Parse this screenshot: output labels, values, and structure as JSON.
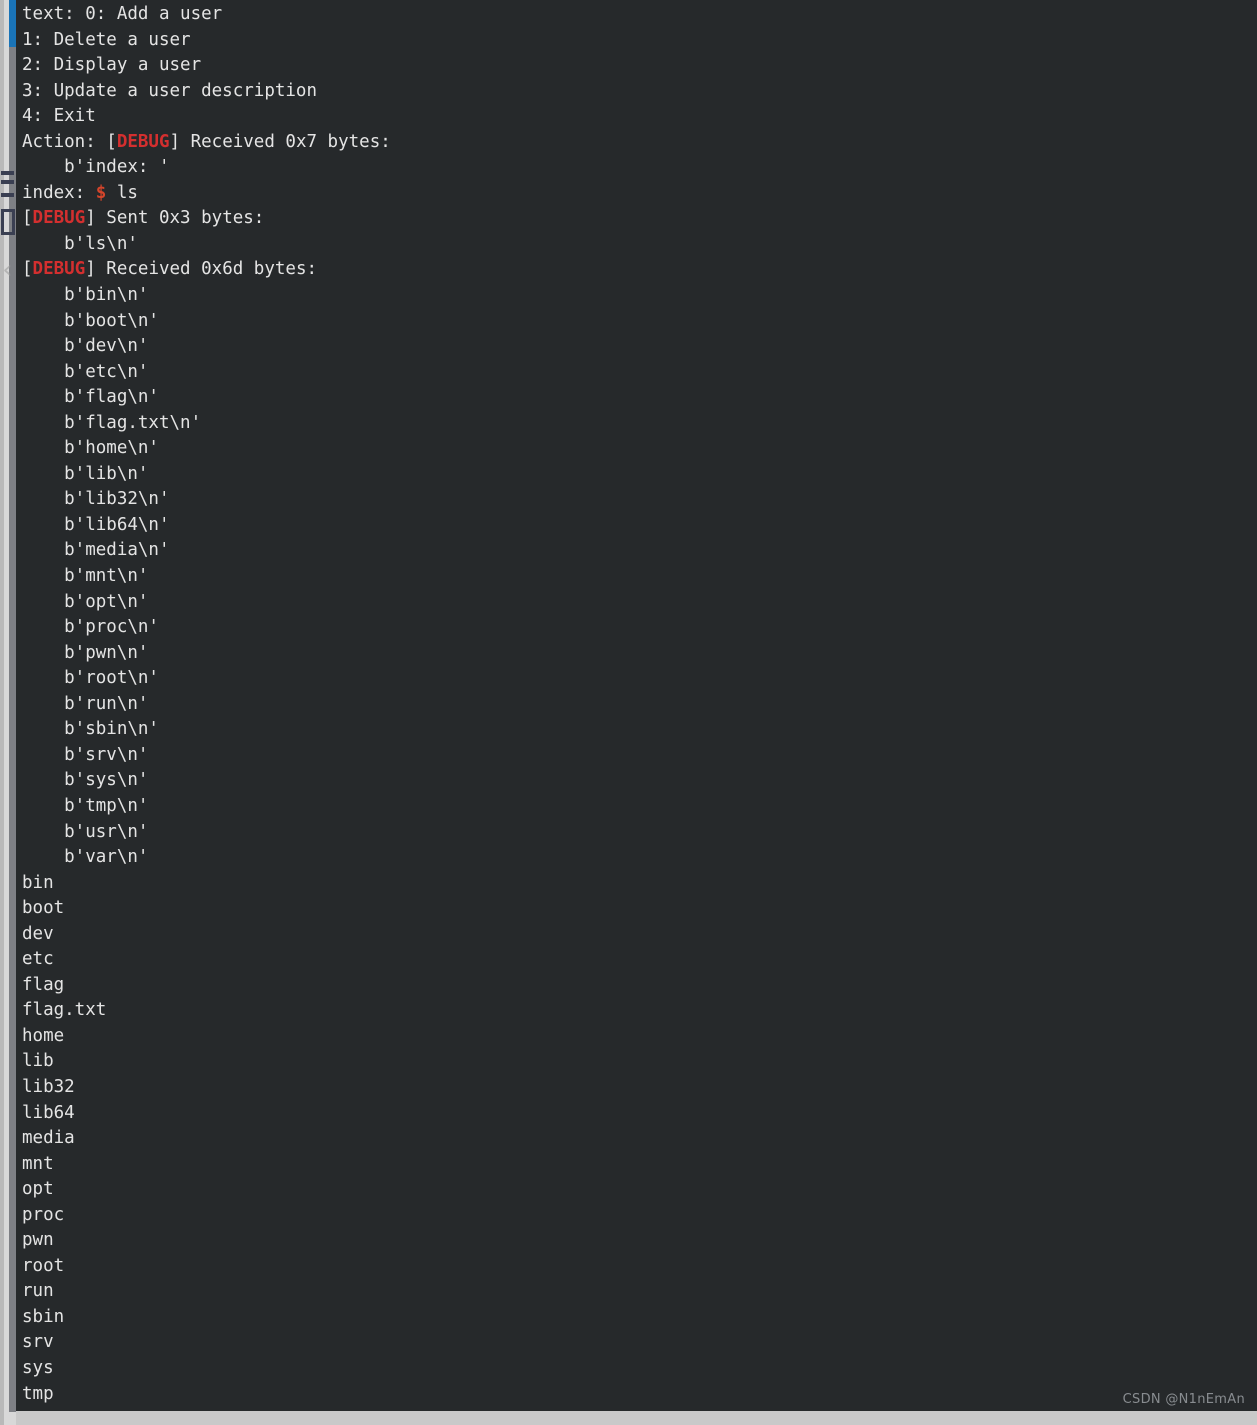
{
  "colors": {
    "background": "#26292b",
    "foreground": "#e4e4e4",
    "debug_red": "#d42f2f",
    "prompt_orange": "#d4452b",
    "gutter_track": "#b9b9b9",
    "gutter_thumb": "#7e8085",
    "gutter_highlight_blue": "#1a74b8",
    "gutter_mark": "#3a3f52",
    "watermark": "#8e9296"
  },
  "gutter": {
    "chevron_glyph": "‹",
    "marks": [
      "mark-a",
      "mark-b",
      "mark-c"
    ],
    "box_label": "bookmark-box"
  },
  "terminal": {
    "menu": [
      "text: 0: Add a user",
      "1: Delete a user",
      "2: Display a user",
      "3: Update a user description",
      "4: Exit"
    ],
    "lines": [
      {
        "type": "plain",
        "text": "text: 0: Add a user"
      },
      {
        "type": "plain",
        "text": "1: Delete a user"
      },
      {
        "type": "plain",
        "text": "2: Display a user"
      },
      {
        "type": "plain",
        "text": "3: Update a user description"
      },
      {
        "type": "plain",
        "text": "4: Exit"
      },
      {
        "type": "debug",
        "prefix": "Action: [",
        "tag": "DEBUG",
        "suffix": "] Received 0x7 bytes:"
      },
      {
        "type": "plain",
        "text": "    b'index: '"
      },
      {
        "type": "prompt",
        "prefix": "index: ",
        "symbol": "$",
        "suffix": " ls"
      },
      {
        "type": "debug",
        "prefix": "[",
        "tag": "DEBUG",
        "suffix": "] Sent 0x3 bytes:"
      },
      {
        "type": "plain",
        "text": "    b'ls\\n'"
      },
      {
        "type": "debug",
        "prefix": "[",
        "tag": "DEBUG",
        "suffix": "] Received 0x6d bytes:"
      },
      {
        "type": "plain",
        "text": "    b'bin\\n'"
      },
      {
        "type": "plain",
        "text": "    b'boot\\n'"
      },
      {
        "type": "plain",
        "text": "    b'dev\\n'"
      },
      {
        "type": "plain",
        "text": "    b'etc\\n'"
      },
      {
        "type": "plain",
        "text": "    b'flag\\n'"
      },
      {
        "type": "plain",
        "text": "    b'flag.txt\\n'"
      },
      {
        "type": "plain",
        "text": "    b'home\\n'"
      },
      {
        "type": "plain",
        "text": "    b'lib\\n'"
      },
      {
        "type": "plain",
        "text": "    b'lib32\\n'"
      },
      {
        "type": "plain",
        "text": "    b'lib64\\n'"
      },
      {
        "type": "plain",
        "text": "    b'media\\n'"
      },
      {
        "type": "plain",
        "text": "    b'mnt\\n'"
      },
      {
        "type": "plain",
        "text": "    b'opt\\n'"
      },
      {
        "type": "plain",
        "text": "    b'proc\\n'"
      },
      {
        "type": "plain",
        "text": "    b'pwn\\n'"
      },
      {
        "type": "plain",
        "text": "    b'root\\n'"
      },
      {
        "type": "plain",
        "text": "    b'run\\n'"
      },
      {
        "type": "plain",
        "text": "    b'sbin\\n'"
      },
      {
        "type": "plain",
        "text": "    b'srv\\n'"
      },
      {
        "type": "plain",
        "text": "    b'sys\\n'"
      },
      {
        "type": "plain",
        "text": "    b'tmp\\n'"
      },
      {
        "type": "plain",
        "text": "    b'usr\\n'"
      },
      {
        "type": "plain",
        "text": "    b'var\\n'"
      },
      {
        "type": "plain",
        "text": "bin"
      },
      {
        "type": "plain",
        "text": "boot"
      },
      {
        "type": "plain",
        "text": "dev"
      },
      {
        "type": "plain",
        "text": "etc"
      },
      {
        "type": "plain",
        "text": "flag"
      },
      {
        "type": "plain",
        "text": "flag.txt"
      },
      {
        "type": "plain",
        "text": "home"
      },
      {
        "type": "plain",
        "text": "lib"
      },
      {
        "type": "plain",
        "text": "lib32"
      },
      {
        "type": "plain",
        "text": "lib64"
      },
      {
        "type": "plain",
        "text": "media"
      },
      {
        "type": "plain",
        "text": "mnt"
      },
      {
        "type": "plain",
        "text": "opt"
      },
      {
        "type": "plain",
        "text": "proc"
      },
      {
        "type": "plain",
        "text": "pwn"
      },
      {
        "type": "plain",
        "text": "root"
      },
      {
        "type": "plain",
        "text": "run"
      },
      {
        "type": "plain",
        "text": "sbin"
      },
      {
        "type": "plain",
        "text": "srv"
      },
      {
        "type": "plain",
        "text": "sys"
      },
      {
        "type": "plain",
        "text": "tmp"
      }
    ],
    "debug_tag": "DEBUG",
    "prompt_symbol": "$",
    "received_7_bytes": "Received 0x7 bytes:",
    "sent_3_bytes": "Sent 0x3 bytes:",
    "received_6d_bytes": "Received 0x6d bytes:",
    "command": "ls",
    "directory_listing": [
      "bin",
      "boot",
      "dev",
      "etc",
      "flag",
      "flag.txt",
      "home",
      "lib",
      "lib32",
      "lib64",
      "media",
      "mnt",
      "opt",
      "proc",
      "pwn",
      "root",
      "run",
      "sbin",
      "srv",
      "sys",
      "tmp"
    ],
    "byte_listing": [
      "bin",
      "boot",
      "dev",
      "etc",
      "flag",
      "flag.txt",
      "home",
      "lib",
      "lib32",
      "lib64",
      "media",
      "mnt",
      "opt",
      "proc",
      "pwn",
      "root",
      "run",
      "sbin",
      "srv",
      "sys",
      "tmp",
      "usr",
      "var"
    ]
  },
  "watermark": {
    "text": "CSDN @N1nEmAn"
  }
}
